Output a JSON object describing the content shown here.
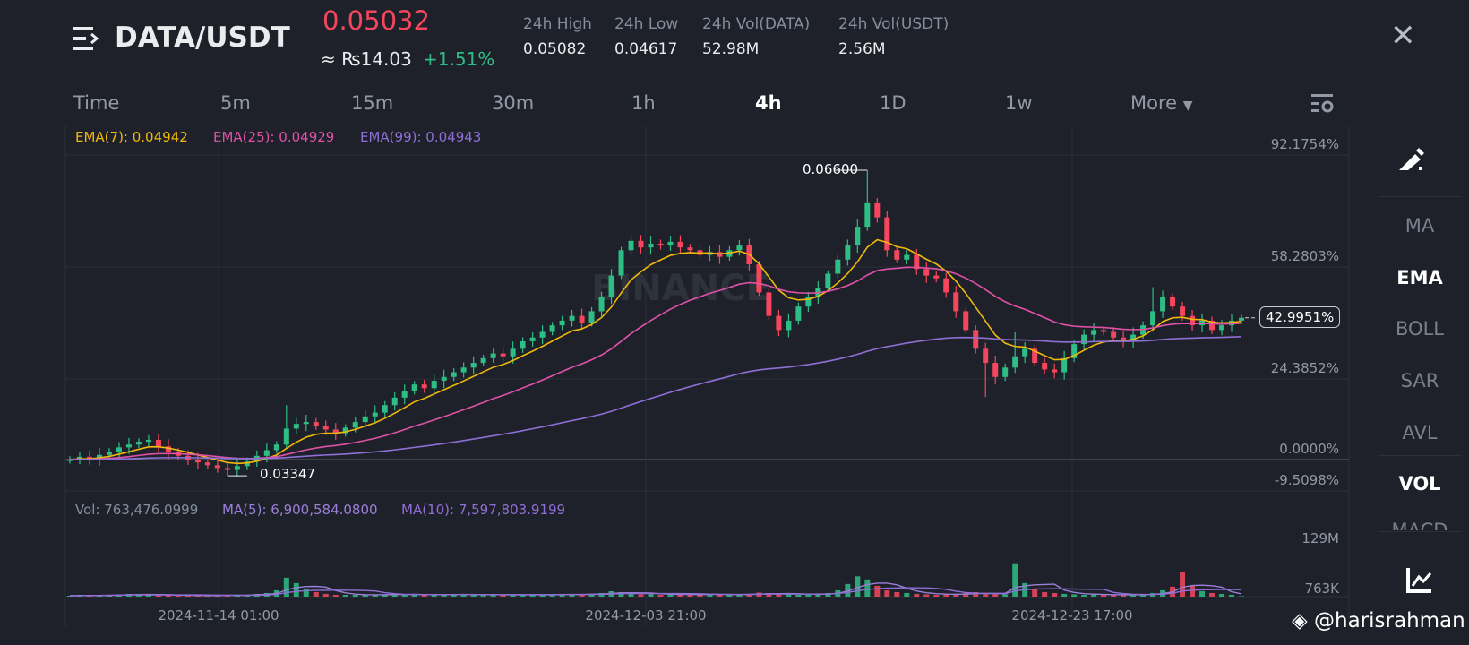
{
  "header": {
    "pair": "DATA/USDT",
    "price": "0.05032",
    "fiat": "≈ ₨14.03",
    "change": "+1.51%",
    "stats": [
      {
        "label": "24h High",
        "value": "0.05082"
      },
      {
        "label": "24h Low",
        "value": "0.04617"
      },
      {
        "label": "24h Vol(DATA)",
        "value": "52.98M"
      },
      {
        "label": "24h Vol(USDT)",
        "value": "2.56M"
      }
    ],
    "close_icon": "close-icon",
    "menu_icon": "menu-icon"
  },
  "tabs": [
    "Time",
    "5m",
    "15m",
    "30m",
    "1h",
    "4h",
    "1D",
    "1w",
    "More"
  ],
  "active_tab": "4h",
  "legend": {
    "ema7": "EMA(7): 0.04942",
    "ema25": "EMA(25): 0.04929",
    "ema99": "EMA(99): 0.04943"
  },
  "vol_legend": {
    "vol": "Vol: 763,476.0999",
    "ma5": "MA(5): 6,900,584.0800",
    "ma10": "MA(10): 7,597,803.9199"
  },
  "sidebar": [
    "MA",
    "EMA",
    "BOLL",
    "SAR",
    "AVL",
    "VOL",
    "MACD"
  ],
  "watermark": "@harisrahman",
  "chart_watermark": "BINANCE",
  "colors": {
    "up": "#2ebd85",
    "down": "#f6465d",
    "ema7": "#f0b90b",
    "ema25": "#e052a8",
    "ema99": "#8f6fd6"
  },
  "chart_data": {
    "type": "candlestick",
    "base_price": 0.0352,
    "y_ticks": [
      "92.1754%",
      "58.2803%",
      "24.3852%",
      "0.0000%",
      "-9.5098%"
    ],
    "y_tick_values": [
      92.1754,
      58.2803,
      24.3852,
      0,
      -9.5098
    ],
    "current_label": "42.9951%",
    "high_label": "0.06600",
    "low_label": "0.03347",
    "vol_ticks": [
      "129M",
      "763K"
    ],
    "x_labels": [
      "2024-11-14 01:00",
      "2024-12-03 21:00",
      "2024-12-23 17:00"
    ],
    "closes": [
      0.0352,
      0.0355,
      0.0353,
      0.0357,
      0.036,
      0.0365,
      0.0368,
      0.0371,
      0.0373,
      0.0366,
      0.036,
      0.0356,
      0.0352,
      0.0349,
      0.0346,
      0.0343,
      0.0341,
      0.0345,
      0.035,
      0.0356,
      0.0362,
      0.0368,
      0.0385,
      0.039,
      0.0392,
      0.0388,
      0.0384,
      0.038,
      0.0386,
      0.0392,
      0.0398,
      0.0402,
      0.041,
      0.0418,
      0.0425,
      0.0432,
      0.0428,
      0.0436,
      0.044,
      0.0445,
      0.045,
      0.0455,
      0.046,
      0.0465,
      0.0462,
      0.047,
      0.0478,
      0.0482,
      0.0488,
      0.0495,
      0.05,
      0.0505,
      0.0498,
      0.051,
      0.0525,
      0.0548,
      0.0575,
      0.0585,
      0.0578,
      0.0582,
      0.058,
      0.0584,
      0.0578,
      0.0575,
      0.057,
      0.0573,
      0.0568,
      0.0575,
      0.058,
      0.056,
      0.053,
      0.0505,
      0.049,
      0.05,
      0.0515,
      0.0525,
      0.0535,
      0.055,
      0.0565,
      0.058,
      0.06,
      0.0625,
      0.061,
      0.0575,
      0.0565,
      0.057,
      0.0555,
      0.0548,
      0.0545,
      0.053,
      0.051,
      0.049,
      0.047,
      0.0455,
      0.044,
      0.045,
      0.0462,
      0.047,
      0.0455,
      0.0448,
      0.0445,
      0.046,
      0.0475,
      0.0485,
      0.049,
      0.0488,
      0.0482,
      0.0478,
      0.0485,
      0.0495,
      0.051,
      0.0525,
      0.0515,
      0.0505,
      0.0495,
      0.05,
      0.049,
      0.0495,
      0.05,
      0.0503
    ],
    "volumes_m": [
      2,
      3,
      2,
      3,
      4,
      5,
      6,
      5,
      4,
      3,
      3,
      2,
      2,
      3,
      2,
      3,
      4,
      3,
      4,
      6,
      8,
      14,
      42,
      30,
      18,
      10,
      6,
      4,
      4,
      4,
      3,
      5,
      5,
      6,
      4,
      5,
      3,
      4,
      5,
      6,
      4,
      3,
      4,
      5,
      4,
      4,
      3,
      5,
      4,
      5,
      6,
      4,
      5,
      6,
      8,
      12,
      10,
      7,
      5,
      6,
      4,
      5,
      4,
      5,
      4,
      6,
      5,
      4,
      4,
      6,
      9,
      8,
      6,
      5,
      4,
      5,
      6,
      8,
      14,
      28,
      45,
      38,
      24,
      14,
      10,
      8,
      6,
      5,
      4,
      5,
      6,
      8,
      10,
      7,
      6,
      5,
      72,
      30,
      18,
      10,
      8,
      6,
      5,
      4,
      5,
      4,
      4,
      3,
      4,
      5,
      8,
      14,
      22,
      55,
      24,
      12,
      8,
      6,
      4,
      1
    ]
  }
}
